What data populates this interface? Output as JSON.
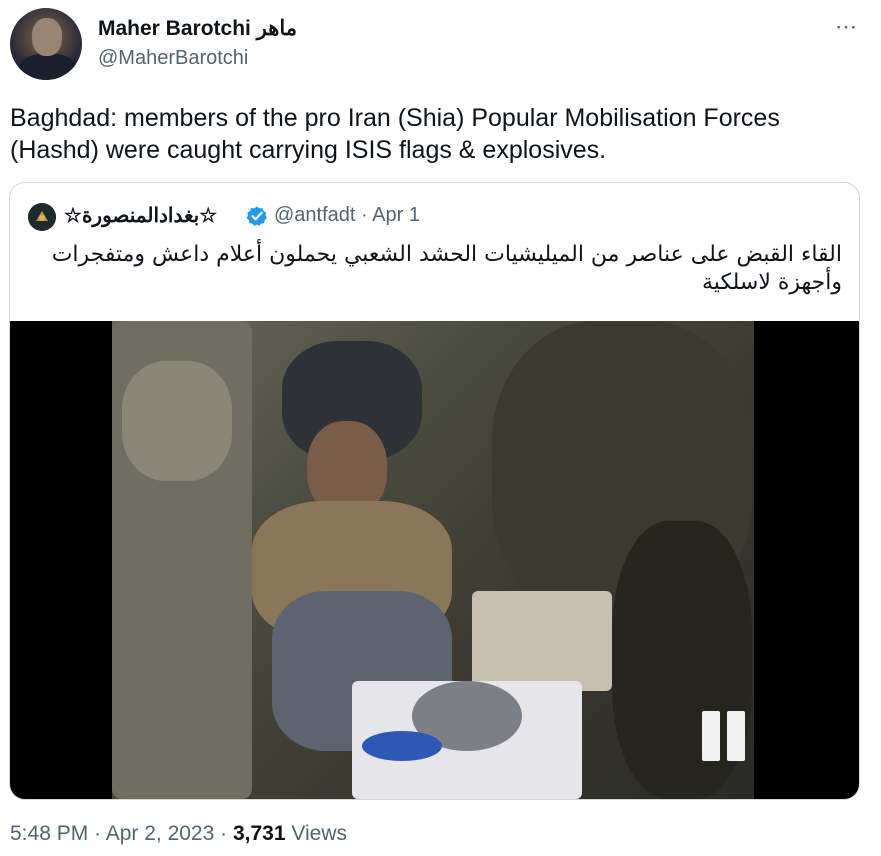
{
  "author": {
    "display_name": "Maher Barotchi ماهر",
    "handle": "@MaherBarotchi",
    "more_icon": "⋯"
  },
  "tweet": {
    "text": "Baghdad: members of the pro Iran (Shia) Popular Mobilisation Forces (Hashd) were caught carrying ISIS flags & explosives."
  },
  "quoted": {
    "display_name": "☆بغدادالمنصورة☆",
    "handle_date": "@antfadt · Apr 1",
    "text": "القاء القبض على عناصر من الميليشيات الحشد الشعبي  يحملون أعلام داعش ومتفجرات وأجهزة لاسلكية"
  },
  "footer": {
    "time": "5:48 PM · Apr 2, 2023 · ",
    "views_count": "3,731",
    "views_label": " Views"
  },
  "colors": {
    "text": "#0f1419",
    "secondary": "#536471",
    "verified": "#1d9bf0",
    "border": "#cfd9de"
  }
}
